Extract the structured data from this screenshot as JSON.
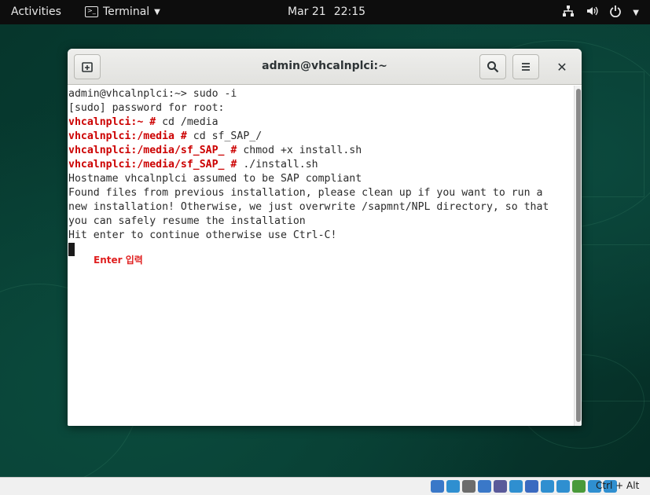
{
  "topbar": {
    "activities": "Activities",
    "app_name": "Terminal",
    "date": "Mar 21",
    "time": "22:15",
    "icons": [
      "network-icon",
      "volume-icon",
      "power-icon",
      "chevron-down-icon"
    ]
  },
  "window": {
    "title": "admin@vhcalnplci:~",
    "buttons": [
      "new-tab-icon",
      "search-icon",
      "hamburger-menu-icon",
      "close-icon"
    ]
  },
  "terminal": {
    "lines": [
      {
        "prompt": "",
        "text": "admin@vhcalnplci:~> sudo -i"
      },
      {
        "prompt": "",
        "text": "[sudo] password for root:"
      },
      {
        "prompt": "vhcalnplci:~ #",
        "text": " cd /media"
      },
      {
        "prompt": "vhcalnplci:/media #",
        "text": " cd sf_SAP_/"
      },
      {
        "prompt": "vhcalnplci:/media/sf_SAP_ #",
        "text": " chmod +x install.sh"
      },
      {
        "prompt": "vhcalnplci:/media/sf_SAP_ #",
        "text": " ./install.sh"
      },
      {
        "prompt": "",
        "text": "Hostname vhcalnplci assumed to be SAP compliant"
      },
      {
        "prompt": "",
        "text": "Found files from previous installation, please clean up if you want to run a"
      },
      {
        "prompt": "",
        "text": "new installation! Otherwise, we just overwrite /sapmnt/NPL directory, so that"
      },
      {
        "prompt": "",
        "text": "you can safely resume the installation"
      },
      {
        "prompt": "",
        "text": "Hit enter to continue otherwise use Ctrl-C!"
      }
    ],
    "annotation": "Enter 입력",
    "prompt_color": "#cc0000",
    "annotation_color": "#e02020"
  },
  "statusbar": {
    "hostkey": "Ctrl + Alt",
    "icons": [
      "hard-disk-icon",
      "optical-drive-icon",
      "audio-icon",
      "network-adapter-icon",
      "usb-icon",
      "shared-folder-icon",
      "display-icon",
      "recording-icon",
      "capture-icon",
      "virtualization-icon",
      "mouse-integration-icon",
      "keyboard-capture-icon"
    ]
  }
}
